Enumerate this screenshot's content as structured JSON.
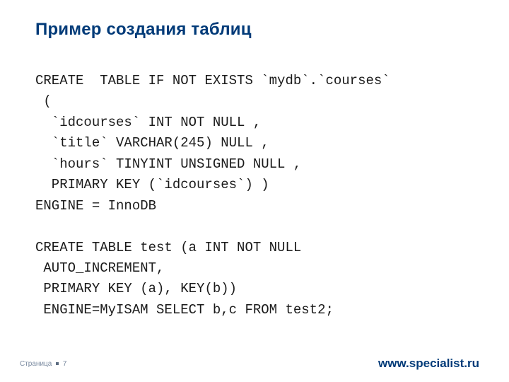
{
  "title": "Пример создания таблиц",
  "code": {
    "l1": "CREATE  TABLE IF NOT EXISTS `mydb`.`courses`",
    "l2": " (",
    "l3": "  `idcourses` INT NOT NULL ,",
    "l4": "  `title` VARCHAR(245) NULL ,",
    "l5": "  `hours` TINYINT UNSIGNED NULL ,",
    "l6": "  PRIMARY KEY (`idcourses`) )",
    "l7": "ENGINE = InnoDB",
    "l8": "",
    "l9": "CREATE TABLE test (a INT NOT NULL",
    "l10": " AUTO_INCREMENT,",
    "l11": " PRIMARY KEY (a), KEY(b))",
    "l12": " ENGINE=MyISAM SELECT b,c FROM test2;"
  },
  "footer": {
    "page_label": "Страница",
    "page_number": "7",
    "site": "www.specialist.ru"
  }
}
